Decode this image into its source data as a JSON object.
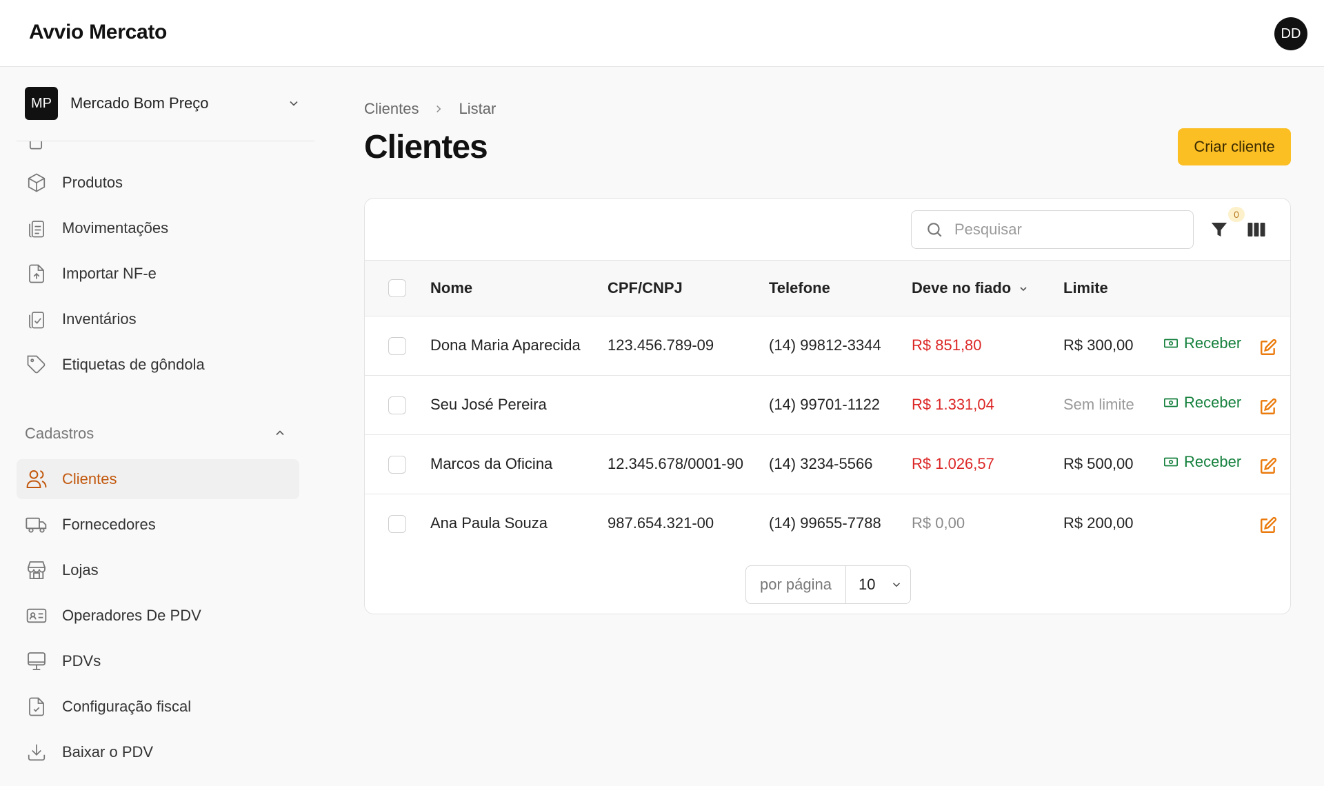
{
  "app": {
    "brand": "Avvio Mercato",
    "user_initials": "DD"
  },
  "store": {
    "initials": "MP",
    "name": "Mercado Bom Preço"
  },
  "sidebar": {
    "items_top": [
      {
        "label": "Produtos",
        "icon": "box-icon"
      },
      {
        "label": "Movimentações",
        "icon": "clipboard-list-icon"
      },
      {
        "label": "Importar NF-e",
        "icon": "file-upload-icon"
      },
      {
        "label": "Inventários",
        "icon": "clipboard-check-icon"
      },
      {
        "label": "Etiquetas de gôndola",
        "icon": "tag-icon"
      }
    ],
    "section_cadastros": "Cadastros",
    "items_cadastros": [
      {
        "label": "Clientes",
        "icon": "users-icon",
        "active": true
      },
      {
        "label": "Fornecedores",
        "icon": "truck-icon"
      },
      {
        "label": "Lojas",
        "icon": "store-icon"
      },
      {
        "label": "Operadores De PDV",
        "icon": "id-card-icon"
      },
      {
        "label": "PDVs",
        "icon": "monitor-icon"
      },
      {
        "label": "Configuração fiscal",
        "icon": "file-check-icon"
      },
      {
        "label": "Baixar o PDV",
        "icon": "download-icon"
      }
    ]
  },
  "breadcrumb": {
    "root": "Clientes",
    "current": "Listar"
  },
  "page": {
    "title": "Clientes",
    "create_label": "Criar cliente"
  },
  "toolbar": {
    "search_placeholder": "Pesquisar",
    "filter_count": "0"
  },
  "table": {
    "columns": [
      "Nome",
      "CPF/CNPJ",
      "Telefone",
      "Deve no fiado",
      "Limite"
    ],
    "receive_label": "Receber",
    "rows": [
      {
        "nome": "Dona Maria Aparecida",
        "cpf": "123.456.789-09",
        "telefone": "(14) 99812-3344",
        "deve": "R$ 851,80",
        "limite": "R$ 300,00",
        "receber": true
      },
      {
        "nome": "Seu José Pereira",
        "cpf": "",
        "telefone": "(14) 99701-1122",
        "deve": "R$ 1.331,04",
        "limite": "Sem limite",
        "receber": true
      },
      {
        "nome": "Marcos da Oficina",
        "cpf": "12.345.678/0001-90",
        "telefone": "(14) 3234-5566",
        "deve": "R$ 1.026,57",
        "limite": "R$ 500,00",
        "receber": true
      },
      {
        "nome": "Ana Paula Souza",
        "cpf": "987.654.321-00",
        "telefone": "(14) 99655-7788",
        "deve": "R$ 0,00",
        "limite": "R$ 200,00",
        "receber": false
      }
    ]
  },
  "pagination": {
    "per_page_label": "por página",
    "per_page_value": "10"
  },
  "colors": {
    "accent": "#fbbf24",
    "active_text": "#c2570c",
    "debt": "#dc2626",
    "receive": "#15803d",
    "edit": "#ea7a0c"
  }
}
